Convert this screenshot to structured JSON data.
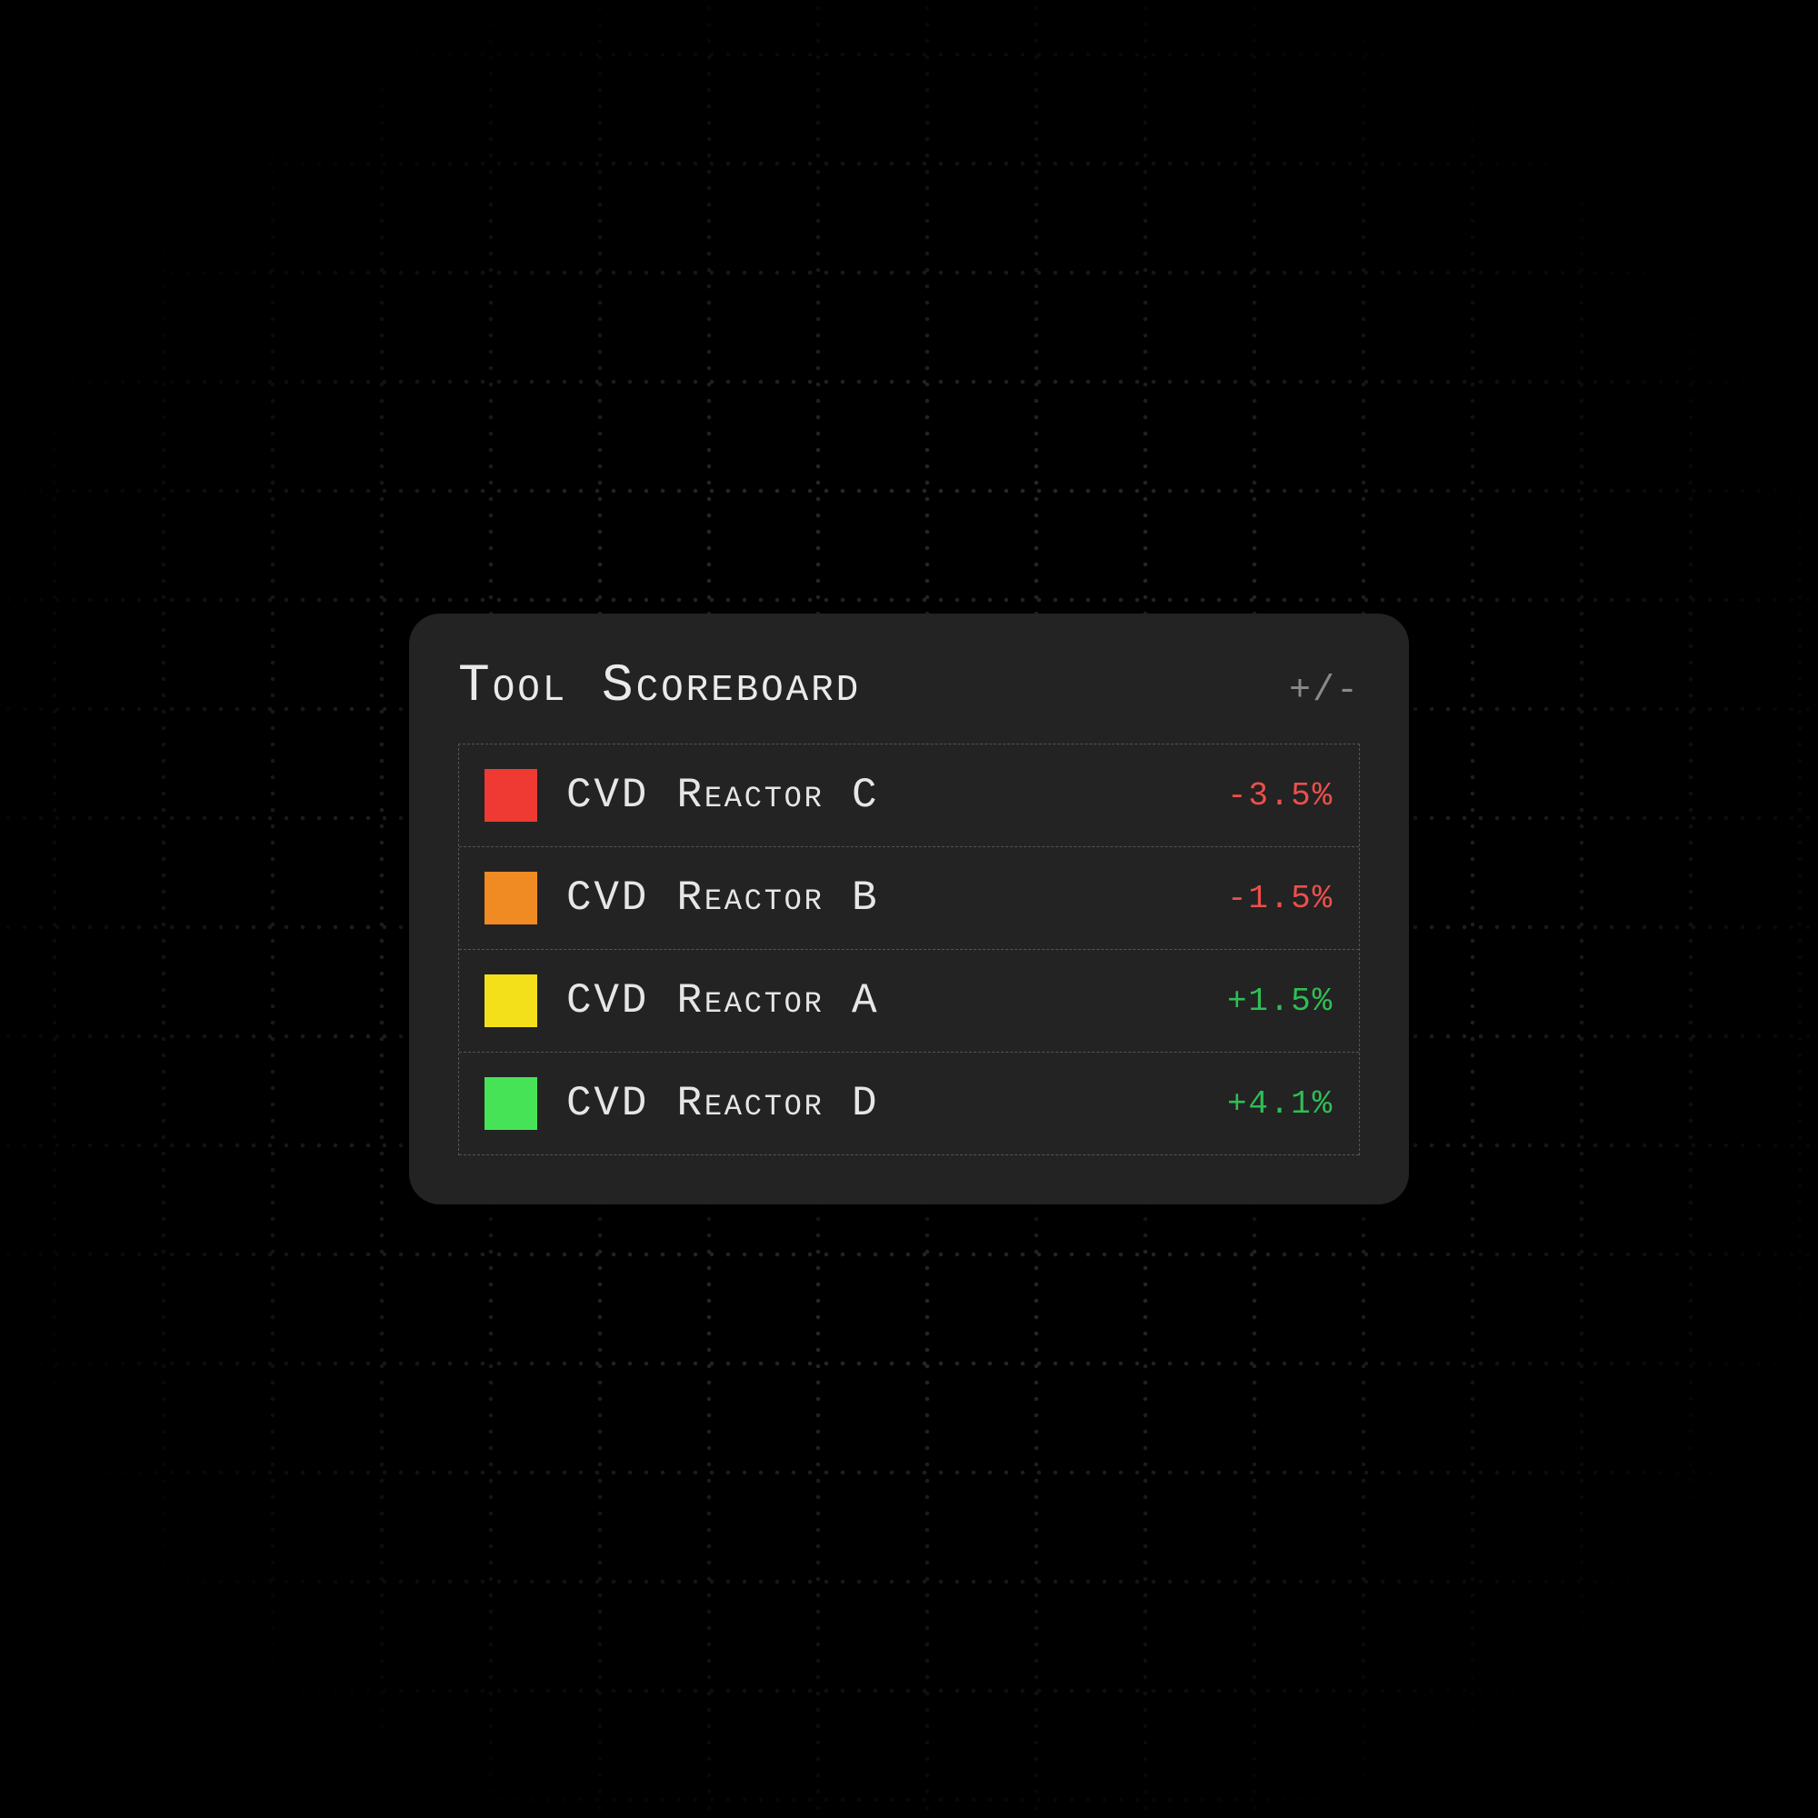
{
  "panel": {
    "title": "Tool Scoreboard",
    "metricLabel": "+/-"
  },
  "colors": {
    "red": "#ee3a32",
    "orange": "#ef8b22",
    "yellow": "#f3e01b",
    "green": "#47e357",
    "negText": "#ed4f4a",
    "posText": "#2fbe55"
  },
  "rows": [
    {
      "swatch": "red",
      "label": "CVD Reactor C",
      "valueText": "-3.5%",
      "sign": "neg"
    },
    {
      "swatch": "orange",
      "label": "CVD Reactor B",
      "valueText": "-1.5%",
      "sign": "neg"
    },
    {
      "swatch": "yellow",
      "label": "CVD Reactor A",
      "valueText": "+1.5%",
      "sign": "pos"
    },
    {
      "swatch": "green",
      "label": "CVD Reactor D",
      "valueText": "+4.1%",
      "sign": "pos"
    }
  ]
}
